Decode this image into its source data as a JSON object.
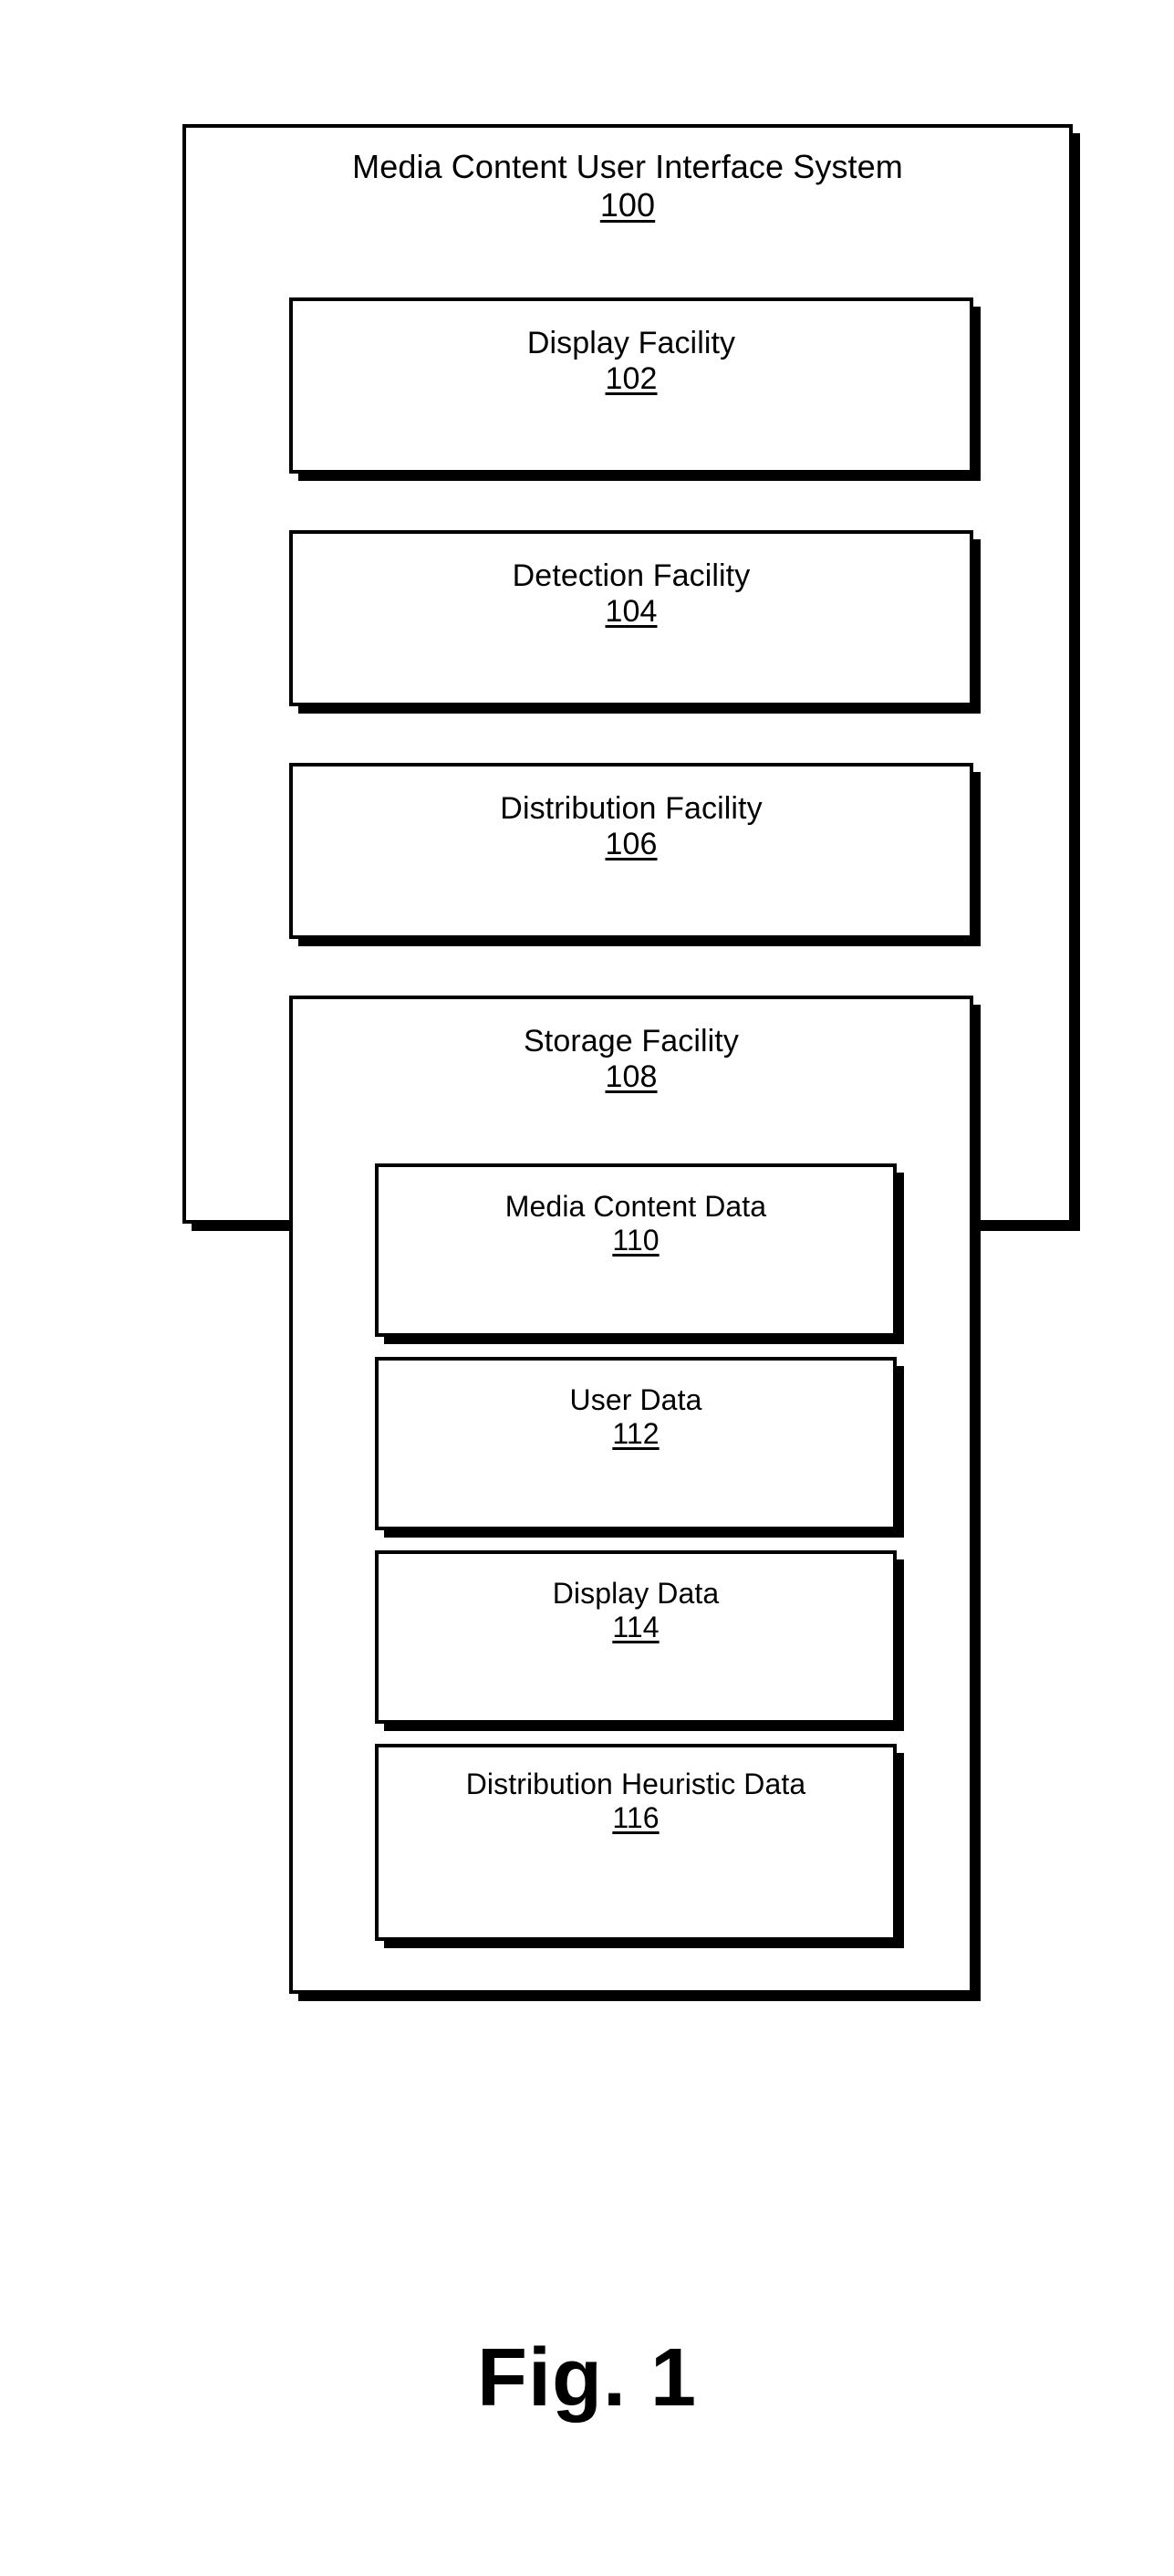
{
  "figure": {
    "caption": "Fig. 1"
  },
  "system": {
    "title": "Media Content User Interface System",
    "ref": "100"
  },
  "facilities": [
    {
      "name": "display",
      "label": "Display Facility",
      "ref": "102"
    },
    {
      "name": "detection",
      "label": "Detection Facility",
      "ref": "104"
    },
    {
      "name": "distribution",
      "label": "Distribution Facility",
      "ref": "106"
    }
  ],
  "storage": {
    "label": "Storage Facility",
    "ref": "108",
    "items": [
      {
        "name": "media-content-data",
        "label": "Media Content Data",
        "ref": "110"
      },
      {
        "name": "user-data",
        "label": "User Data",
        "ref": "112"
      },
      {
        "name": "display-data",
        "label": "Display Data",
        "ref": "114"
      },
      {
        "name": "distribution-heuristic",
        "label": "Distribution Heuristic Data",
        "ref": "116"
      }
    ]
  }
}
